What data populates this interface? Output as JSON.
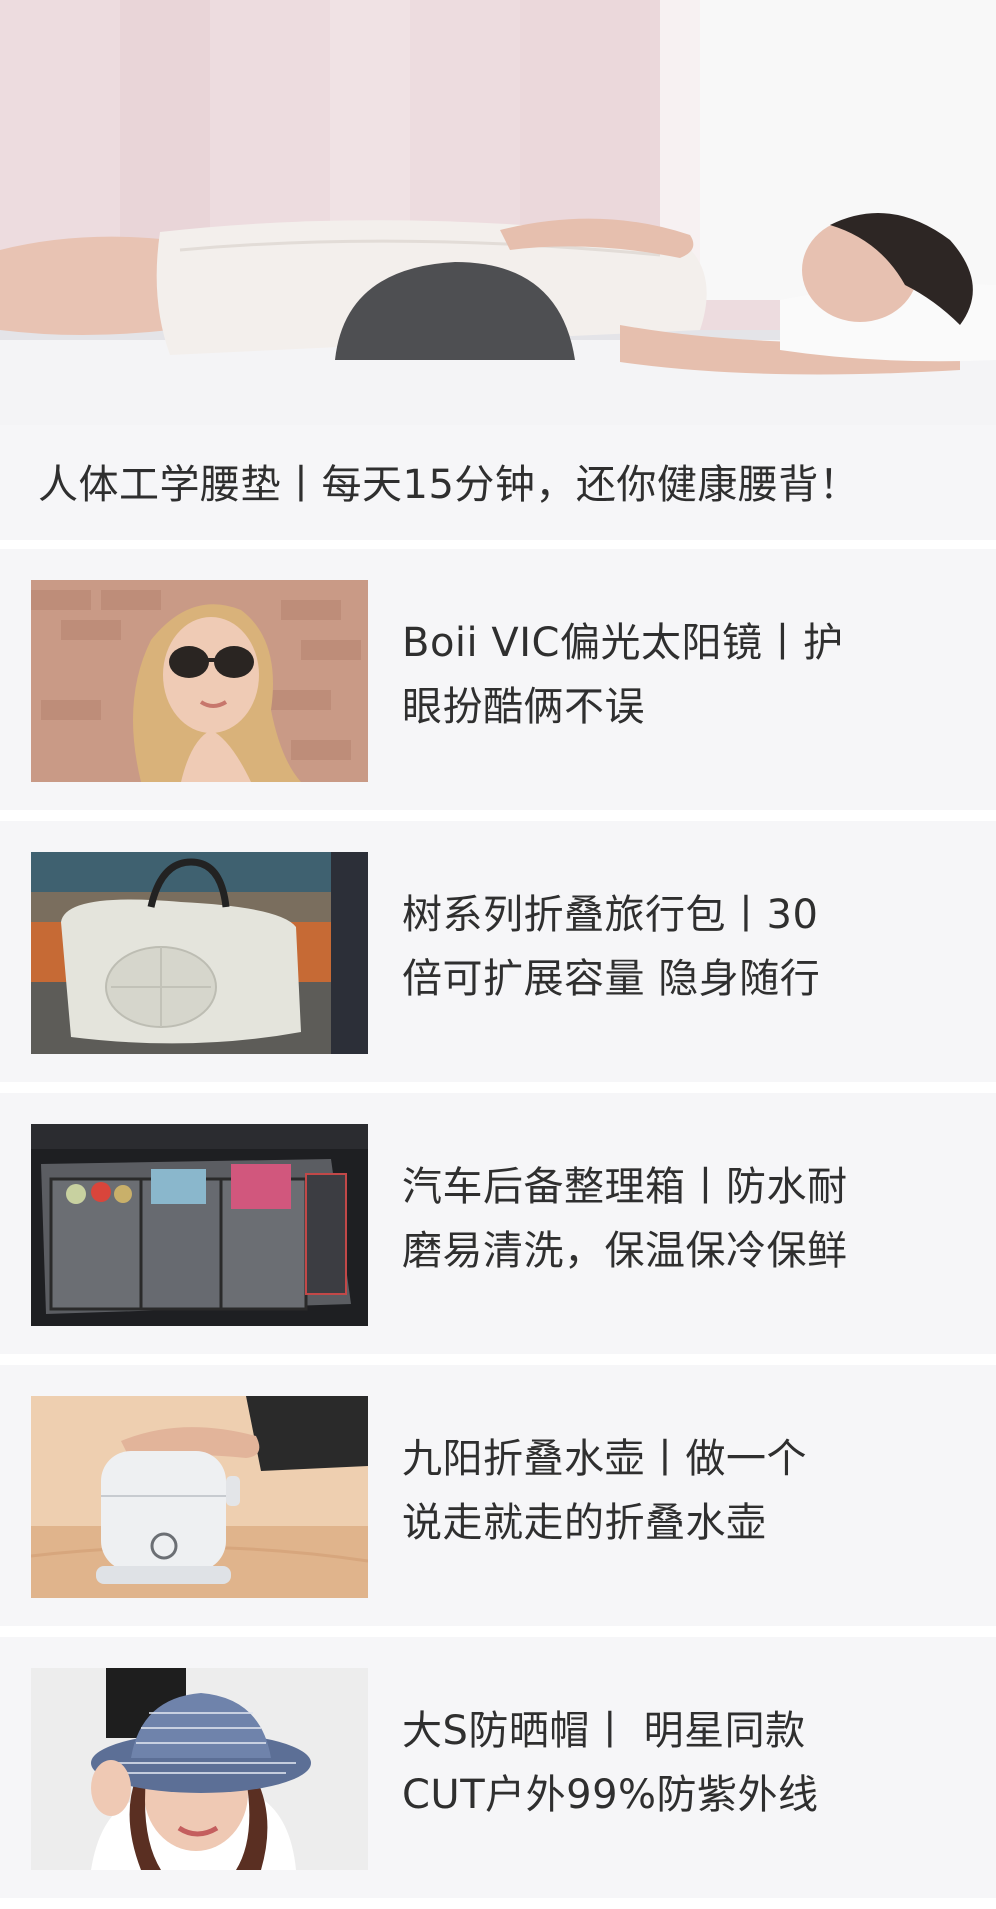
{
  "hero": {
    "title": "人体工学腰垫丨每天15分钟，还你健康腰背！",
    "image_subject": "woman-lying-on-lumbar-cushion"
  },
  "articles": [
    {
      "title_line1": "Boii VIC偏光太阳镜丨护",
      "title_line2": "眼扮酷俩不误",
      "image_subject": "woman-wearing-sunglasses"
    },
    {
      "title_line1": "树系列折叠旅行包丨30",
      "title_line2": "倍可扩展容量 隐身随行",
      "image_subject": "folding-travel-bag"
    },
    {
      "title_line1": "汽车后备整理箱丨防水耐",
      "title_line2": "磨易清洗，保温保冷保鲜",
      "image_subject": "car-trunk-organizer"
    },
    {
      "title_line1": "九阳折叠水壶丨做一个",
      "title_line2": "说走就走的折叠水壶",
      "image_subject": "folding-kettle"
    },
    {
      "title_line1": "大S防晒帽丨  明星同款",
      "title_line2": "CUT户外99%防紫外线",
      "image_subject": "woman-in-sun-hat"
    }
  ],
  "colors": {
    "card_background": "#f6f6f8",
    "separator": "#ffffff",
    "text": "#2f2f2f"
  }
}
